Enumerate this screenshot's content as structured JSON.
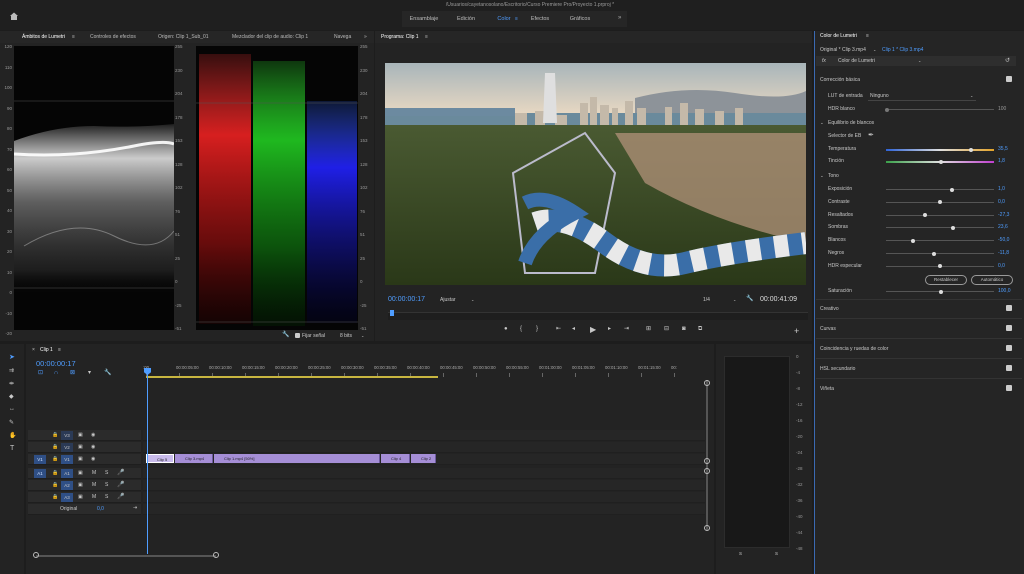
{
  "window": {
    "title": "/Usuarios/cayetanosolano/Escritorio/Curso Premiere Pro/Proyecto 1.prproj *"
  },
  "workspaces": [
    {
      "label": "Ensamblaje"
    },
    {
      "label": "Edición"
    },
    {
      "label": "Color",
      "active": true
    },
    {
      "label": "Efectos"
    },
    {
      "label": "Gráficos"
    }
  ],
  "source_panel": {
    "tabs": [
      "Ámbitos de Lumetri",
      "Controles de efectos",
      "Origen: Clip 1_Sub_01",
      "Mezclador del clip de audio: Clip 1",
      "Navega"
    ],
    "waveform_scale": [
      "120",
      "110",
      "100",
      "90",
      "80",
      "70",
      "60",
      "50",
      "40",
      "30",
      "20",
      "10",
      "0",
      "-10",
      "-20"
    ],
    "waveform_right": [
      "255",
      "230",
      "204",
      "178",
      "153",
      "128",
      "102",
      "76",
      "51",
      "25",
      "0",
      "-25",
      "-51"
    ],
    "parade_scale": [
      "255",
      "230",
      "204",
      "178",
      "153",
      "128",
      "102",
      "76",
      "51",
      "25",
      "0",
      "-25",
      "-51"
    ],
    "clamp_label": "Fijar señal",
    "bits": "8 bits"
  },
  "program": {
    "tab": "Programa: Clip 1",
    "timecode": "00:00:00:17",
    "fit": "Ajustar",
    "ratio": "1/4",
    "duration": "00:00:41:09"
  },
  "timeline": {
    "tab": "Clip 1",
    "timecode": "00:00:00:17",
    "ruler": [
      ":00",
      "00:00:05:00",
      "00:00:10:00",
      "00:00:15:00",
      "00:00:20:00",
      "00:00:25:00",
      "00:00:30:00",
      "00:00:35:00",
      "00:00:40:00",
      "00:00:45:00",
      "00:00:50:00",
      "00:00:55:00",
      "00:01:00:00",
      "00:01:05:00",
      "00:01:10:00",
      "00:01:15:00",
      "00:"
    ],
    "video_tracks": [
      "V3",
      "V2",
      "V1"
    ],
    "audio_tracks": [
      "A1",
      "A2",
      "A3"
    ],
    "source_v": "V1",
    "source_a": "A1",
    "mute": "M",
    "solo": "S",
    "master": "Original",
    "master_value": "0,0",
    "clips": [
      "Clip 5",
      "Clip 3.mp4",
      "Clip 1.mp4 [50%]",
      "Clip 4",
      "Clip 2"
    ],
    "meter_scale": [
      "0",
      "-4",
      "-8",
      "-12",
      "-16",
      "-20",
      "-24",
      "-28",
      "-32",
      "-36",
      "-40",
      "-44",
      "-48"
    ],
    "meter_bottom": [
      "S",
      "S"
    ]
  },
  "lumetri": {
    "tab": "Color de Lumetri",
    "source": "Original * Clip 3.mp4",
    "target": "Clip 1 * Clip 3.mp4",
    "fx": "fx",
    "effect": "Color de Lumetri",
    "basic": "Corrección básica",
    "lut_label": "LUT de entrada",
    "lut_value": "Ninguno",
    "hdr_label": "HDR blanco",
    "hdr_value": "100",
    "wb": "Equilibrio de blancos",
    "wb_selector": "Selector de EB",
    "temp_label": "Temperatura",
    "temp_value": "35,5",
    "tint_label": "Tinción",
    "tint_value": "1,8",
    "tone": "Tono",
    "tone_rows": [
      {
        "label": "Exposición",
        "value": "1,0",
        "pos": 0.61
      },
      {
        "label": "Contraste",
        "value": "0,0",
        "pos": 0.5
      },
      {
        "label": "Resaltados",
        "value": "-27,3",
        "pos": 0.36
      },
      {
        "label": "Sombras",
        "value": "23,6",
        "pos": 0.62
      },
      {
        "label": "Blancos",
        "value": "-50,0",
        "pos": 0.25
      },
      {
        "label": "Negros",
        "value": "-11,8",
        "pos": 0.44
      },
      {
        "label": "HDR especular",
        "value": "0,0",
        "pos": 0.5
      }
    ],
    "reset": "Restablecer",
    "auto": "Automático",
    "sat_label": "Saturación",
    "sat_value": "100,0",
    "sections": [
      "Creativo",
      "Curvas",
      "Coincidencia y ruedas de color",
      "HSL secundario",
      "Viñeta"
    ]
  },
  "colors": {
    "accent": "#4f9dff",
    "clip": "#a58ed6",
    "track_active": "#2f4f85"
  },
  "icons": [
    "home-icon",
    "wrench-icon",
    "play-icon",
    "step-back-icon",
    "step-forward-icon",
    "camera-icon",
    "eyedropper-icon",
    "reset-icon",
    "selection-tool-icon",
    "razor-tool-icon",
    "hand-tool-icon",
    "type-tool-icon",
    "lock-icon",
    "eye-icon",
    "mic-icon",
    "plus-icon"
  ]
}
